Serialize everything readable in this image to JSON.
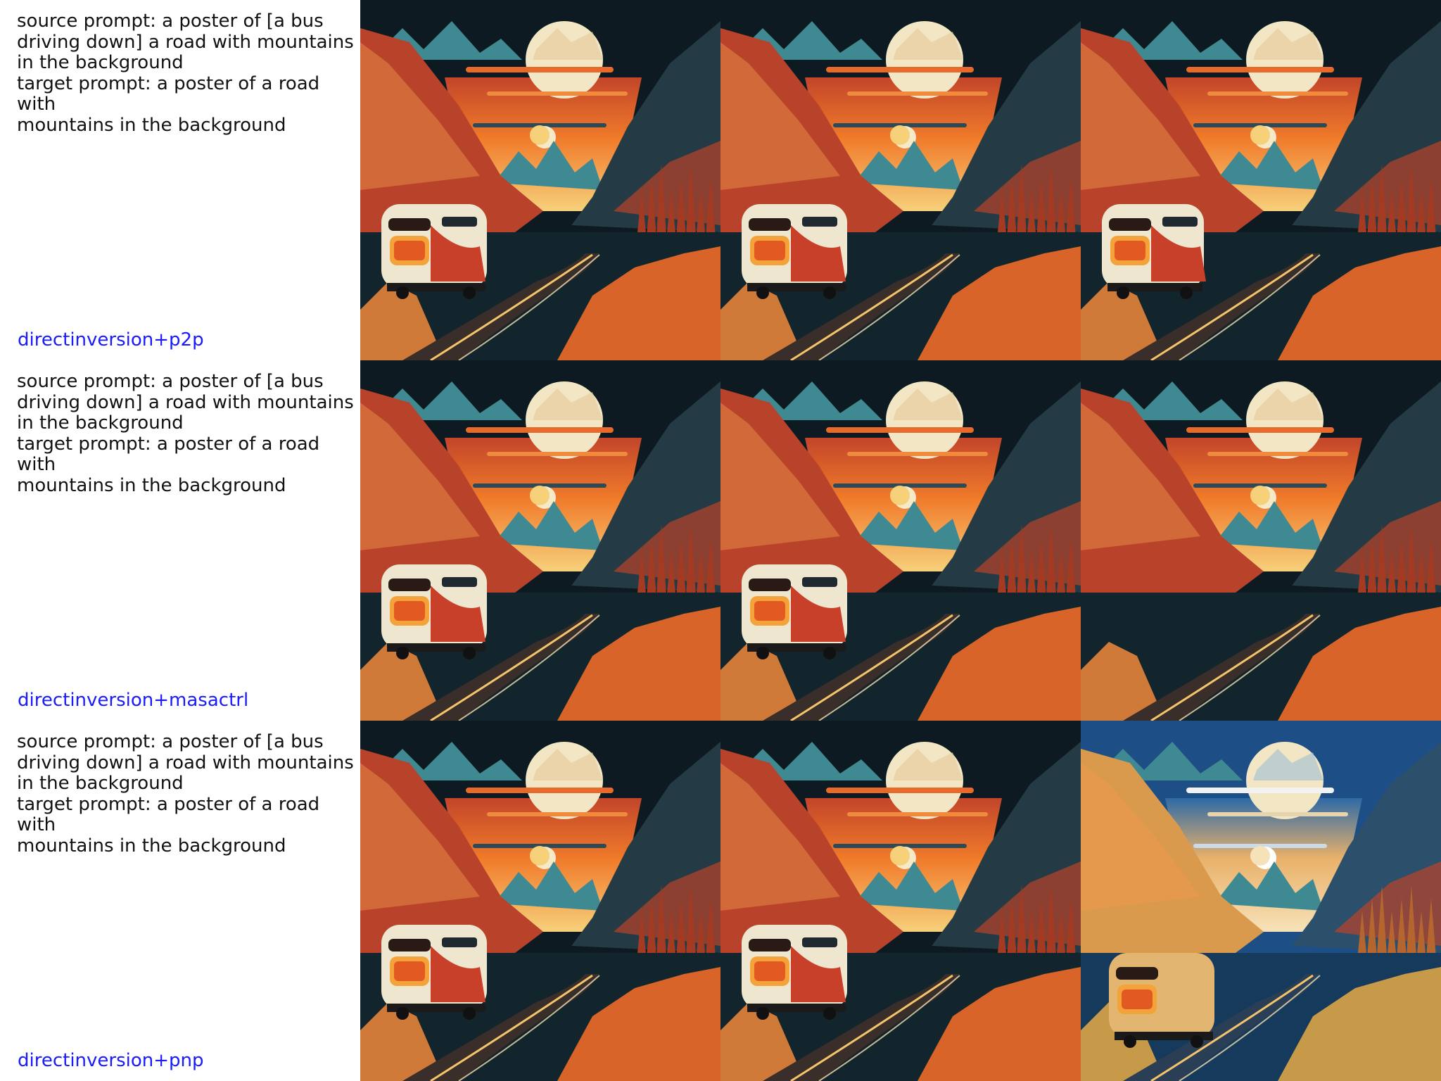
{
  "rows": [
    {
      "source_prompt": "source prompt: a poster of [a bus driving down] a road with mountains in the background",
      "source_lines": [
        "source prompt: a poster of [a bus",
        "driving down] a road with mountains",
        "in the background"
      ],
      "target_lines": [
        "target prompt: a poster of a road with",
        "mountains in the background"
      ],
      "method": "directinversion+p2p",
      "panels": [
        {
          "name": "source-image",
          "bus": true,
          "variant": "normal"
        },
        {
          "name": "reconstruction-image",
          "bus": true,
          "variant": "normal"
        },
        {
          "name": "edited-image",
          "bus": true,
          "variant": "rear-bus"
        }
      ]
    },
    {
      "source_lines": [
        "source prompt: a poster of [a bus",
        "driving down] a road with mountains",
        "in the background"
      ],
      "target_lines": [
        "target prompt: a poster of a road with",
        "mountains in the background"
      ],
      "method": "directinversion+masactrl",
      "panels": [
        {
          "name": "source-image",
          "bus": true,
          "variant": "normal"
        },
        {
          "name": "reconstruction-image",
          "bus": true,
          "variant": "normal"
        },
        {
          "name": "edited-image",
          "bus": false,
          "variant": "no-bus"
        }
      ]
    },
    {
      "source_lines": [
        "source prompt: a poster of [a bus",
        "driving down] a road with mountains",
        "in the background"
      ],
      "target_lines": [
        "target prompt: a poster of a road with",
        "mountains in the background"
      ],
      "method": "directinversion+pnp",
      "panels": [
        {
          "name": "source-image",
          "bus": true,
          "variant": "normal"
        },
        {
          "name": "reconstruction-image",
          "bus": true,
          "variant": "normal"
        },
        {
          "name": "edited-image",
          "bus": true,
          "variant": "blue"
        }
      ]
    }
  ],
  "colors": {
    "method_label": "#1a1aff",
    "sky_orange": "#f07a2a",
    "sky_yellow": "#f7d07a",
    "moon": "#f3e6c4",
    "night": "#0d1a22",
    "teal_mountains": "#3f8a92",
    "red_mountains": "#b8432a",
    "blue_variant": "#1d4f86"
  }
}
